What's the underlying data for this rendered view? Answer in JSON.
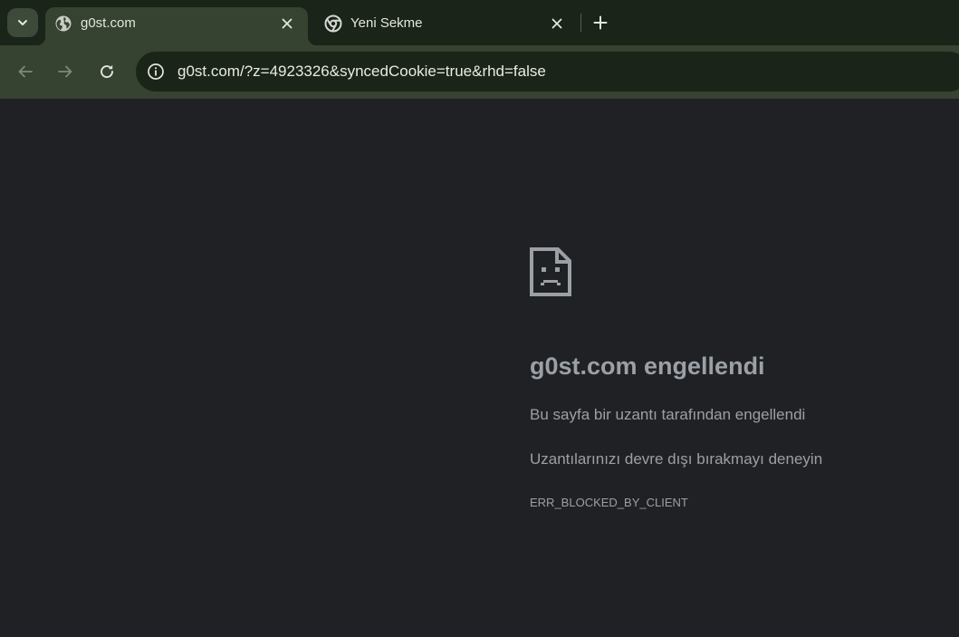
{
  "browser": {
    "tabs": [
      {
        "title": "g0st.com",
        "active": true,
        "favicon": "globe-icon"
      },
      {
        "title": "Yeni Sekme",
        "active": false,
        "favicon": "chrome-icon"
      }
    ],
    "address_bar": {
      "url": "g0st.com/?z=4923326&syncedCookie=true&rhd=false"
    },
    "colors": {
      "tabstrip": "#1a2418",
      "toolbar": "#354330",
      "page_background": "#202124",
      "error_text": "#9aa0a6"
    }
  },
  "error_page": {
    "icon": "sad-document-icon",
    "title": "g0st.com engellendi",
    "message": "Bu sayfa bir uzantı tarafından engellendi",
    "suggestion": "Uzantılarınızı devre dışı bırakmayı deneyin",
    "code": "ERR_BLOCKED_BY_CLIENT"
  }
}
